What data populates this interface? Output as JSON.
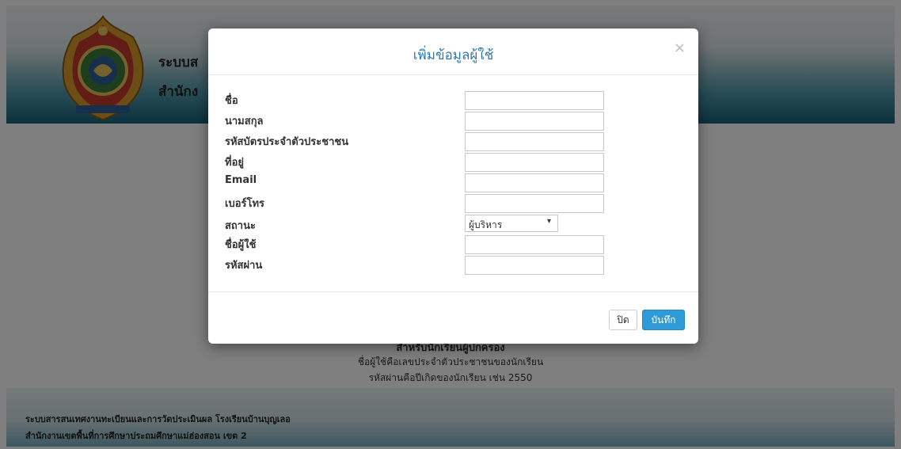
{
  "header": {
    "title": "ระบบส",
    "subtitle": "สำนักง"
  },
  "info": {
    "heading": "สำหรับนักเรียนผู้ปกครอง",
    "line1": "ชื่อผู้ใช้คือเลขประจำตัวประชาชนของนักเรียน",
    "line2": "รหัสผ่านคือปีเกิดของนักเรียน เช่น 2550"
  },
  "footer": {
    "line1": "ระบบสารสนเทศงานทะเบียนและการวัดประเมินผล โรงเรียนบ้านบุญเลอ",
    "line2": "สำนักงานเขตพื้นที่การศึกษาประถมศึกษาแม่ฮ่องสอน เขต 2"
  },
  "modal": {
    "title": "เพิ่มข้อมูลผู้ใช้",
    "close_icon": "×",
    "fields": [
      {
        "label": "ชื่อ",
        "value": ""
      },
      {
        "label": "นามสกุล",
        "value": ""
      },
      {
        "label": "รหัสบัตรประจำตัวประชาชน",
        "value": ""
      },
      {
        "label": "ที่อยู่",
        "value": ""
      },
      {
        "label": "Email",
        "value": ""
      },
      {
        "label": "เบอร์โทร",
        "value": ""
      },
      {
        "label": "สถานะ",
        "selected": "ผู้บริหาร"
      },
      {
        "label": "ชื่อผู้ใช้",
        "value": ""
      },
      {
        "label": "รหัสผ่าน",
        "value": ""
      }
    ],
    "buttons": {
      "close": "ปิด",
      "save": "บันทึก"
    }
  },
  "colors": {
    "title_blue": "#2a7aaf",
    "save_button": "#2f9ad8",
    "header_teal": "#17637a"
  },
  "icons": {
    "emblem": "school-emblem-icon",
    "close": "close-icon",
    "dropdown": "chevron-down-icon"
  }
}
